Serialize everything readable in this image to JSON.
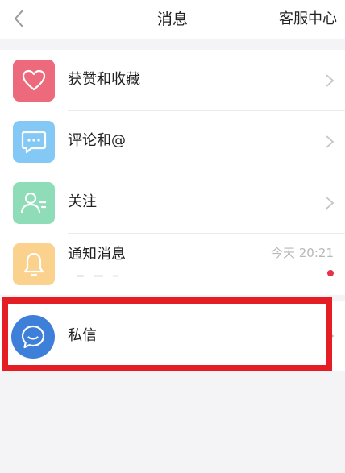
{
  "nav": {
    "title": "消息",
    "right_action": "客服中心",
    "back_icon": "chevron-left-icon"
  },
  "items": [
    {
      "label": "获赞和收藏",
      "icon": "heart-icon",
      "color": "#ec6a7c"
    },
    {
      "label": "评论和@",
      "icon": "chat-bubble-icon",
      "color": "#84c9f5"
    },
    {
      "label": "关注",
      "icon": "users-icon",
      "color": "#8fdcb8"
    },
    {
      "label": "通知消息",
      "icon": "bell-icon",
      "color": "#fad28e",
      "time": "今天 20:21",
      "unread_dot_color": "#e8324a"
    }
  ],
  "direct_message": {
    "label": "私信",
    "icon": "message-circle-icon",
    "color": "#3d7fd9"
  },
  "highlight_color": "#e51e25"
}
